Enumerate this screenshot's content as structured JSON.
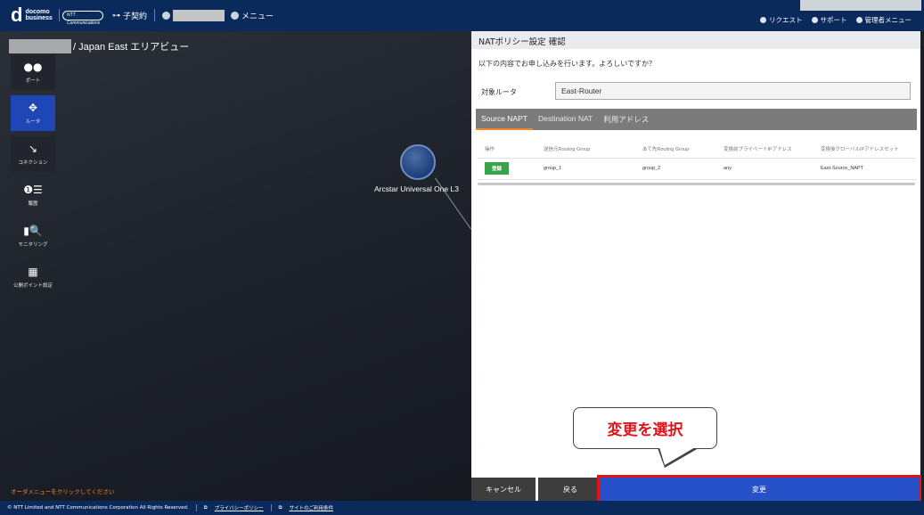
{
  "header": {
    "brand_line1": "docomo",
    "brand_line2": "business",
    "partner_logo": "NTT Communications",
    "contract_label": "子契約",
    "menu_label": "メニュー",
    "right_items": [
      {
        "icon": "bell-icon",
        "label": "リクエスト"
      },
      {
        "icon": "support-icon",
        "label": "サポート"
      },
      {
        "icon": "gear-icon",
        "label": "管理者メニュー"
      }
    ]
  },
  "stage": {
    "breadcrumb_suffix": "/ Japan East エリアビュー",
    "sidebar": [
      {
        "icon": "port-icon",
        "glyph": "●●",
        "label": "ポート",
        "active": false
      },
      {
        "icon": "router-icon",
        "glyph": "✥",
        "label": "ルータ",
        "active": true
      },
      {
        "icon": "connection-icon",
        "glyph": "↘",
        "label": "コネクション",
        "active": false
      },
      {
        "icon": "history-icon",
        "glyph": "❶☰",
        "label": "履歴",
        "active": false
      },
      {
        "icon": "monitoring-icon",
        "glyph": "▮🔍",
        "label": "モニタリング",
        "active": false
      },
      {
        "icon": "public-point-icon",
        "glyph": "▦",
        "label": "公開ポイント設定",
        "active": false
      }
    ],
    "node_label": "Arcstar Universal One L3",
    "order_message": "オーダメニューをクリックしてください"
  },
  "panel": {
    "title": "NATポリシー設定 確認",
    "confirm_message": "以下の内容でお申し込みを行います。よろしいですか？",
    "router_label": "対象ルータ",
    "router_value": "East-Router",
    "tabs": [
      "Source NAPT",
      "Destination NAT",
      "利用アドレス"
    ],
    "table": {
      "headers": [
        "操作",
        "送信元Routing Group",
        "あて先Routing Group",
        "変換前プライベートIPアドレス",
        "変換後グローバルIPアドレスセット"
      ],
      "rows": [
        {
          "action": "登録",
          "src": "group_1",
          "dst": "group_2",
          "private_ip": "any",
          "global_ip": "East-Source_NAPT"
        }
      ]
    },
    "buttons": {
      "cancel": "キャンセル",
      "back": "戻る",
      "change": "変更"
    }
  },
  "callout": {
    "text": "変更を選択"
  },
  "footer": {
    "copyright": "© NTT Limited and NTT Communications Corporation All Rights Reserved.",
    "privacy": "プライバシーポリシー",
    "terms": "サイトのご利用条件"
  },
  "colors": {
    "header_bg": "#0b2a5c",
    "accent_blue": "#2751c9",
    "highlight_red": "#e0131b",
    "badge_green": "#3aa24a",
    "tab_orange": "#f08a2a"
  }
}
